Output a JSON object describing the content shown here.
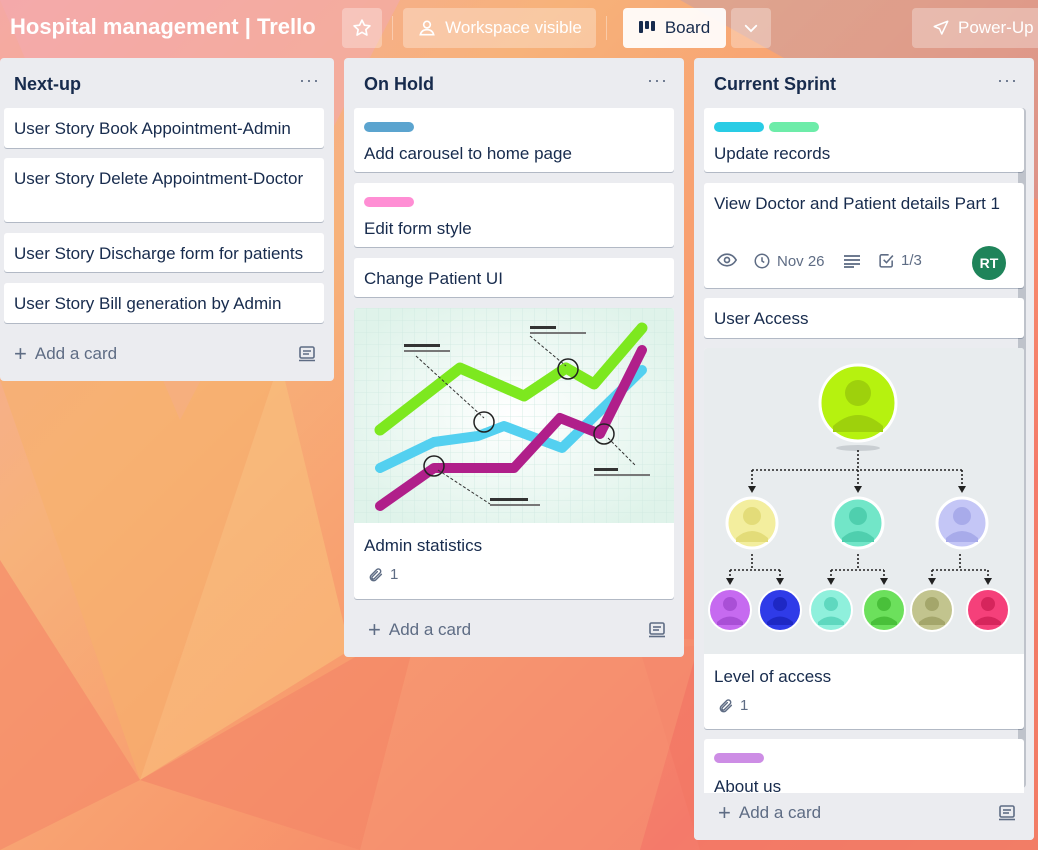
{
  "header": {
    "board_title": "Hospital management | Trello",
    "star_icon": "star-icon",
    "visibility_label": "Workspace visible",
    "view_label": "Board",
    "powerups_label": "Power-Up"
  },
  "lists": [
    {
      "title": "Next-up",
      "menu": "···",
      "cards": [
        {
          "title": "User Story Book Appointment-Admin"
        },
        {
          "title": "User Story Delete Appointment-Doctor"
        },
        {
          "title": "User Story Discharge form for patients"
        },
        {
          "title": "User Story Bill generation by Admin"
        }
      ],
      "add_card": "Add a card"
    },
    {
      "title": "On Hold",
      "menu": "···",
      "cards": [
        {
          "title": "Add carousel to home page",
          "labels": [
            "#5ba4cf"
          ]
        },
        {
          "title": "Edit form style",
          "labels": [
            "#ff8ed4"
          ]
        },
        {
          "title": "Change Patient UI"
        },
        {
          "title": "Admin statistics",
          "attachments": "1",
          "cover": "line-chart-illustration"
        }
      ],
      "add_card": "Add a card"
    },
    {
      "title": "Current Sprint",
      "menu": "···",
      "cards": [
        {
          "title": "Update records",
          "labels": [
            "#29cce5",
            "#6deca9"
          ]
        },
        {
          "title": "View Doctor and Patient details Part 1",
          "due": "Nov 26",
          "checklist": "1/3",
          "member": "RT"
        },
        {
          "title": "User Access"
        },
        {
          "title": "Level of access",
          "attachments": "1",
          "cover": "hierarchy-diagram-illustration"
        },
        {
          "title": "About us",
          "labels": [
            "#cd8de5"
          ]
        }
      ],
      "add_card": "Add a card"
    }
  ],
  "colors": {
    "list_bg": "#ebecf0",
    "text": "#172b4d",
    "muted": "#5e6c84",
    "member_avatar": "#1f845a"
  }
}
